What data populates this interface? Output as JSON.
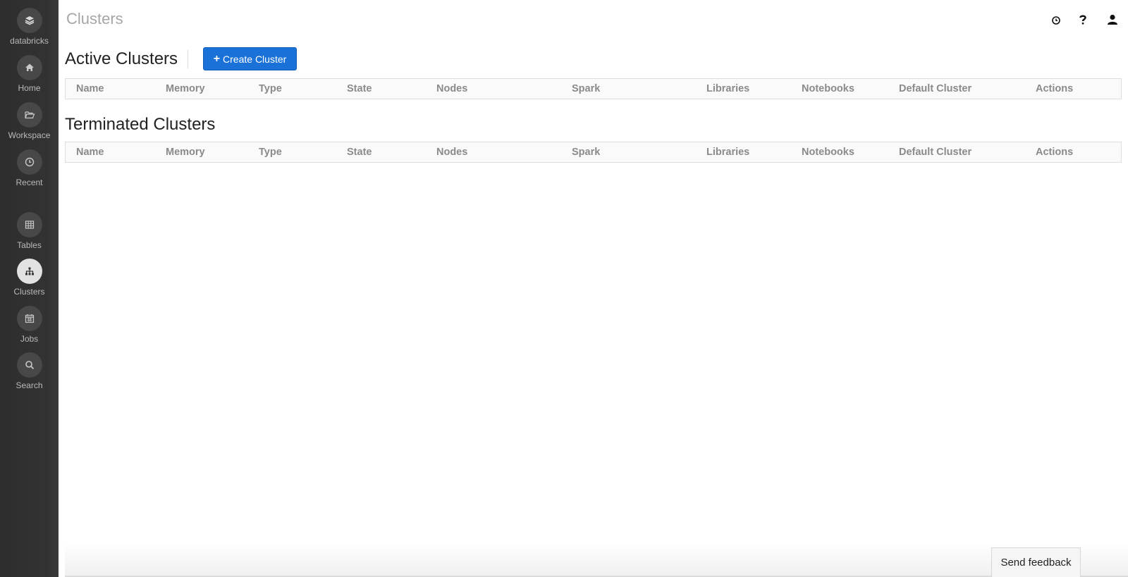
{
  "sidebar": {
    "brand": {
      "label": "databricks",
      "icon": "layers-icon"
    },
    "items": [
      {
        "label": "Home",
        "icon": "home-icon",
        "active": false
      },
      {
        "label": "Workspace",
        "icon": "folder-open-icon",
        "active": false
      },
      {
        "label": "Recent",
        "icon": "clock-icon",
        "active": false
      },
      {
        "label": "Tables",
        "icon": "table-grid-icon",
        "active": false
      },
      {
        "label": "Clusters",
        "icon": "sitemap-icon",
        "active": true
      },
      {
        "label": "Jobs",
        "icon": "calendar-icon",
        "active": false
      },
      {
        "label": "Search",
        "icon": "search-icon",
        "active": false
      }
    ]
  },
  "header": {
    "title": "Clusters",
    "icons": [
      "clock-icon",
      "help-icon",
      "user-icon"
    ]
  },
  "active": {
    "title": "Active Clusters",
    "create_label": "Create Cluster",
    "columns": [
      "Name",
      "Memory",
      "Type",
      "State",
      "Nodes",
      "Spark",
      "Libraries",
      "Notebooks",
      "Default Cluster",
      "Actions"
    ]
  },
  "terminated": {
    "title": "Terminated Clusters",
    "columns": [
      "Name",
      "Memory",
      "Type",
      "State",
      "Nodes",
      "Spark",
      "Libraries",
      "Notebooks",
      "Default Cluster",
      "Actions"
    ]
  },
  "feedback": {
    "label": "Send feedback"
  },
  "colors": {
    "sidebar": "#333333",
    "accent": "#1a72d8",
    "header_text": "#8a8a8a"
  }
}
